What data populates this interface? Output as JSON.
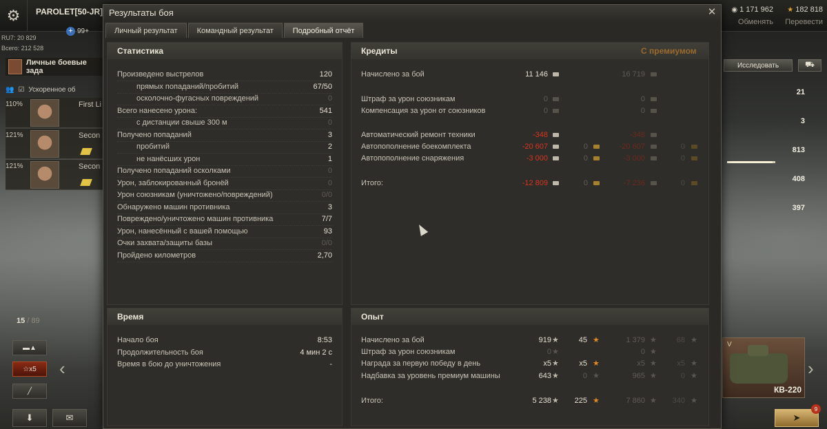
{
  "topbar": {
    "player_name": "PAROLET[50-JR]",
    "notifications": "99+",
    "rating_ru7": "RU7: 20 829",
    "rating_total": "Всего: 212 528",
    "credits_amount": "1 171 962",
    "credits_label": "Обменять",
    "gold_amount": "182 818",
    "gold_label": "Перевести"
  },
  "left_panel": {
    "missions_label": "Личные боевые зада",
    "accel_label": "Ускоренное об",
    "crew": [
      {
        "pct": "110%",
        "role": "First Li"
      },
      {
        "pct": "121%",
        "role": "Secon"
      },
      {
        "pct": "121%",
        "role": "Secon"
      }
    ],
    "tank_counter_current": "15",
    "tank_counter_total": "/ 89",
    "x5_label": "x5"
  },
  "right_panel": {
    "research_label": "Исследовать",
    "stats": [
      "21",
      "3",
      "813",
      "408",
      "397"
    ],
    "stat_bar_fraction": 0.94,
    "tank_name": "КВ-220",
    "tank_level": "V",
    "fight_count": "9"
  },
  "dialog": {
    "title": "Результаты боя",
    "tabs": [
      "Личный результат",
      "Командный результат",
      "Подробный отчёт"
    ],
    "stats_panel": {
      "heading": "Статистика",
      "rows": [
        {
          "label": "Произведено выстрелов",
          "value": "120",
          "indent": false,
          "dim": false
        },
        {
          "label": "прямых попаданий/пробитий",
          "value": "67/50",
          "indent": true,
          "dim": false
        },
        {
          "label": "осколочно-фугасных повреждений",
          "value": "0",
          "indent": true,
          "dim": true
        },
        {
          "label": "Всего нанесено урона:",
          "value": "541",
          "indent": false,
          "dim": false
        },
        {
          "label": "с дистанции свыше 300 м",
          "value": "0",
          "indent": true,
          "dim": true
        },
        {
          "label": "Получено попаданий",
          "value": "3",
          "indent": false,
          "dim": false
        },
        {
          "label": "пробитий",
          "value": "2",
          "indent": true,
          "dim": false
        },
        {
          "label": "не нанёсших урон",
          "value": "1",
          "indent": true,
          "dim": false
        },
        {
          "label": "Получено попаданий осколками",
          "value": "0",
          "indent": false,
          "dim": true
        },
        {
          "label": "Урон, заблокированный бронёй",
          "value": "0",
          "indent": false,
          "dim": true
        },
        {
          "label": "Урон союзникам (уничтожено/повреждений)",
          "value": "0/0",
          "indent": false,
          "dim": true
        },
        {
          "label": "Обнаружено машин противника",
          "value": "3",
          "indent": false,
          "dim": false
        },
        {
          "label": "Повреждено/уничтожено машин противника",
          "value": "7/7",
          "indent": false,
          "dim": false
        },
        {
          "label": "Урон, нанесённый с вашей помощью",
          "value": "93",
          "indent": false,
          "dim": false
        },
        {
          "label": "Очки захвата/защиты базы",
          "value": "0/0",
          "indent": false,
          "dim": true
        },
        {
          "label": "Пройдено километров",
          "value": "2,70",
          "indent": false,
          "dim": false
        }
      ]
    },
    "credits_panel": {
      "heading": "Кредиты",
      "premium_heading": "С премиумом",
      "rows": [
        {
          "label": "Начислено за бой",
          "c1": "11 146",
          "c3": "16 719",
          "style": "pos"
        },
        {
          "label": "Штраф за урон союзникам",
          "c1": "0",
          "c3": "0",
          "style": "dim"
        },
        {
          "label": "Компенсация за урон от союзников",
          "c1": "0",
          "c3": "0",
          "style": "dim"
        },
        {
          "label": "Автоматический ремонт техники",
          "c1": "-348",
          "c3": "-348",
          "style": "neg"
        },
        {
          "label": "Автопополнение боекомплекта",
          "c1": "-20 607",
          "c2": "0",
          "c3": "-20 607",
          "c4": "0",
          "style": "neg"
        },
        {
          "label": "Автопополнение снаряжения",
          "c1": "-3 000",
          "c2": "0",
          "c3": "-3 000",
          "c4": "0",
          "style": "neg"
        },
        {
          "label": "Итого:",
          "c1": "-12 809",
          "c2": "0",
          "c3": "-7 236",
          "c4": "0",
          "style": "neg"
        }
      ]
    },
    "time_panel": {
      "heading": "Время",
      "rows": [
        {
          "label": "Начало боя",
          "value": "8:53"
        },
        {
          "label": "Продолжительность боя",
          "value": "4 мин 2 с"
        },
        {
          "label": "Время в бою до уничтожения",
          "value": "-"
        }
      ]
    },
    "exp_panel": {
      "heading": "Опыт",
      "rows": [
        {
          "label": "Начислено за бой",
          "c1": "919",
          "c2": "45",
          "c3": "1 379",
          "c4": "68"
        },
        {
          "label": "Штраф за урон союзникам",
          "c1": "0",
          "c3": "0"
        },
        {
          "label": "Награда за первую победу в день",
          "c1": "x5",
          "c2": "x5",
          "c3": "x5",
          "c4": "x5"
        },
        {
          "label": "Надбавка за уровень премиум машины",
          "c1": "643",
          "c2": "0",
          "c3": "965",
          "c4": "0"
        },
        {
          "label": "Итого:",
          "c1": "5 238",
          "c2": "225",
          "c3": "7 860",
          "c4": "340"
        }
      ]
    }
  }
}
